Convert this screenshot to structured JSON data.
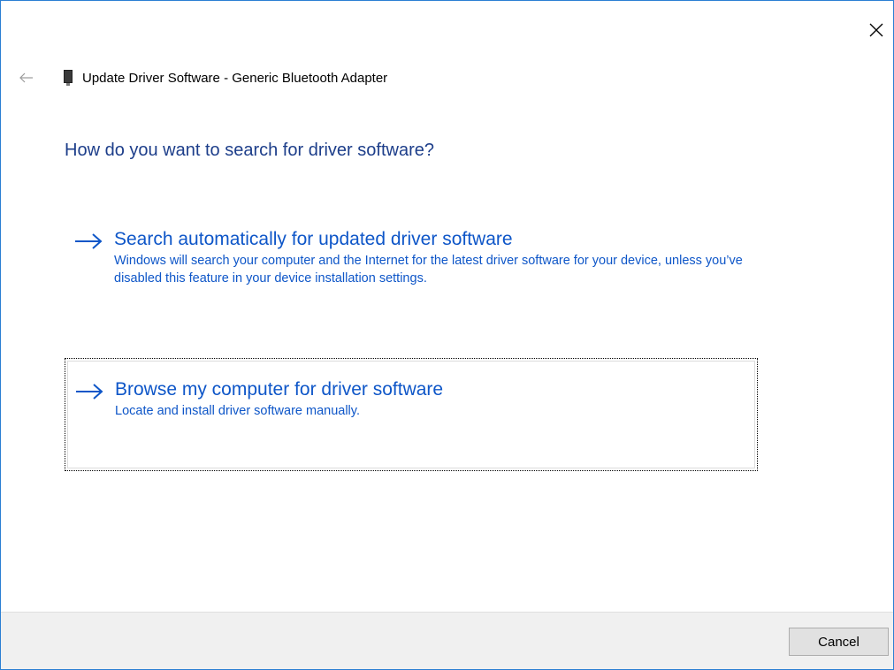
{
  "window": {
    "title": "Update Driver Software - Generic Bluetooth Adapter",
    "close_icon": "close-icon",
    "back_icon": "back-arrow-icon",
    "device_icon": "bluetooth-adapter-icon"
  },
  "main": {
    "question": "How do you want to search for driver software?",
    "options": [
      {
        "title": "Search automatically for updated driver software",
        "description": "Windows will search your computer and the Internet for the latest driver software for your device, unless you’ve disabled this feature in your device installation settings.",
        "icon": "arrow-right-icon"
      },
      {
        "title": "Browse my computer for driver software",
        "description": "Locate and install driver software manually.",
        "icon": "arrow-right-icon"
      }
    ]
  },
  "footer": {
    "cancel_label": "Cancel"
  },
  "colors": {
    "heading": "#1d3e8a",
    "link": "#0e56c8",
    "window_border": "#2b7fd3",
    "footer_bg": "#f0f0f0"
  }
}
